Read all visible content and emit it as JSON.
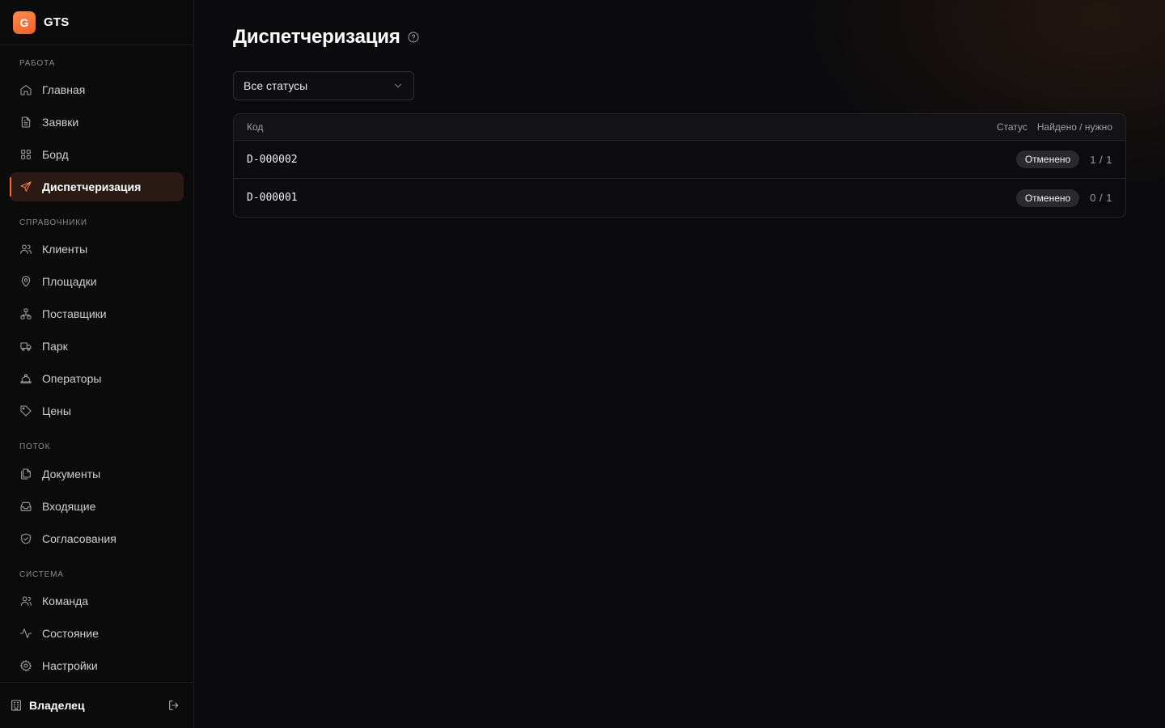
{
  "app": {
    "logo_letter": "G",
    "name": "GTS"
  },
  "sidebar": {
    "sections": [
      {
        "label": "Работа",
        "items": [
          {
            "label": "Главная",
            "icon": "home-icon"
          },
          {
            "label": "Заявки",
            "icon": "document-icon"
          },
          {
            "label": "Борд",
            "icon": "grid-icon"
          },
          {
            "label": "Диспетчеризация",
            "icon": "send-icon",
            "active": true
          }
        ]
      },
      {
        "label": "Справочники",
        "items": [
          {
            "label": "Клиенты",
            "icon": "users-icon"
          },
          {
            "label": "Площадки",
            "icon": "map-pin-icon"
          },
          {
            "label": "Поставщики",
            "icon": "network-icon"
          },
          {
            "label": "Парк",
            "icon": "truck-icon"
          },
          {
            "label": "Операторы",
            "icon": "hard-hat-icon"
          },
          {
            "label": "Цены",
            "icon": "tag-icon"
          }
        ]
      },
      {
        "label": "Поток",
        "items": [
          {
            "label": "Документы",
            "icon": "files-icon"
          },
          {
            "label": "Входящие",
            "icon": "inbox-icon"
          },
          {
            "label": "Согласования",
            "icon": "shield-check-icon"
          }
        ]
      },
      {
        "label": "Система",
        "items": [
          {
            "label": "Команда",
            "icon": "team-icon"
          },
          {
            "label": "Состояние",
            "icon": "activity-icon"
          },
          {
            "label": "Настройки",
            "icon": "gear-icon"
          }
        ]
      }
    ],
    "footer": {
      "role": "Владелец",
      "icon": "building-icon",
      "logout_icon": "logout-icon"
    }
  },
  "page": {
    "title": "Диспетчеризация",
    "help_icon": "help-circle-icon",
    "filter": {
      "selected": "Все статусы",
      "icon": "chevron-down-icon"
    }
  },
  "table": {
    "columns": {
      "code": "Код",
      "status": "Статус",
      "found_needed": "Найдено / нужно"
    },
    "rows": [
      {
        "code": "D-000002",
        "status": "Отменено",
        "count": "1 / 1"
      },
      {
        "code": "D-000001",
        "status": "Отменено",
        "count": "0 / 1"
      }
    ]
  },
  "colors": {
    "accent": "#ff6a2b",
    "background": "#0b0b0d",
    "active_bg": "#2a1a14"
  }
}
